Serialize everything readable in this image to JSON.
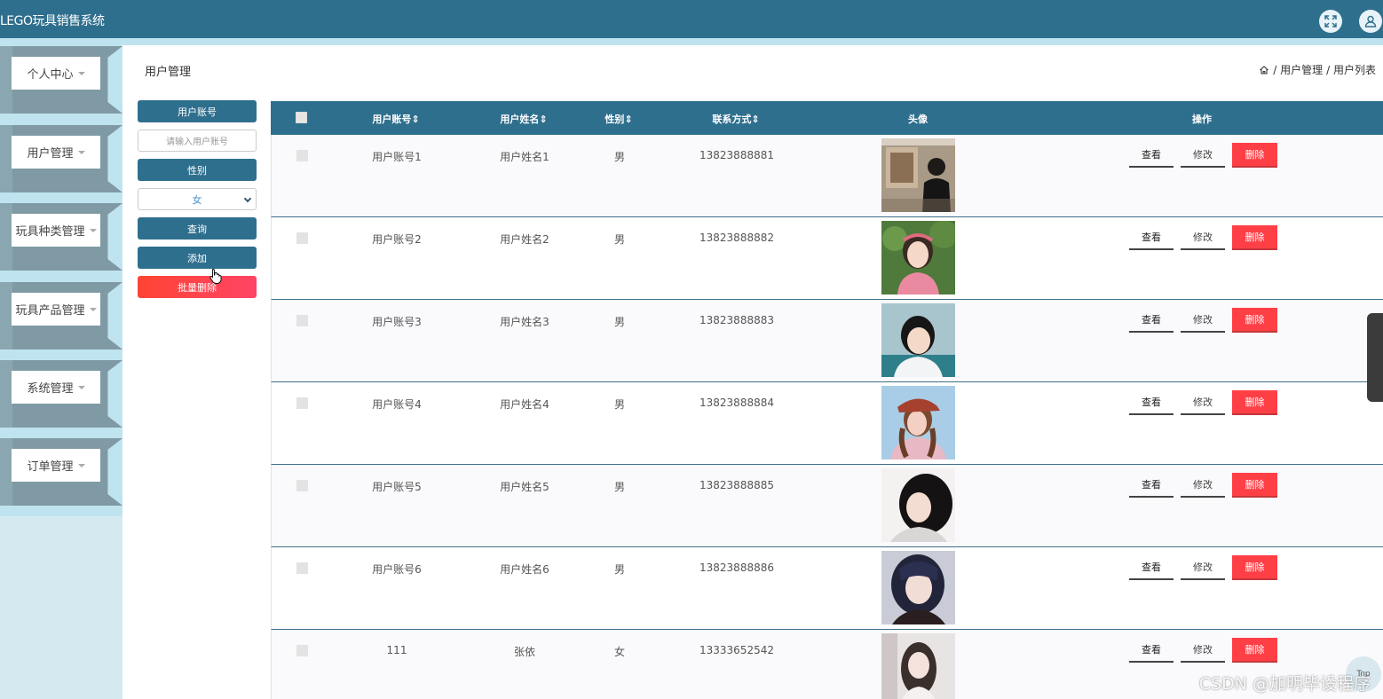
{
  "app": {
    "title": "LEGO玩具销售系统"
  },
  "topbar": {
    "fullscreen_icon": "fullscreen-icon",
    "user_icon": "user-icon"
  },
  "sidebar": {
    "items": [
      {
        "label": "个人中心"
      },
      {
        "label": "用户管理"
      },
      {
        "label": "玩具种类管理"
      },
      {
        "label": "玩具产品管理"
      },
      {
        "label": "系统管理"
      },
      {
        "label": "订单管理"
      }
    ]
  },
  "page": {
    "title": "用户管理",
    "breadcrumb": {
      "home_icon": "home-icon",
      "level1": "/ 用户管理",
      "level2": "/ 用户列表"
    }
  },
  "filters": {
    "account_label": "用户账号",
    "account_placeholder": "请输入用户账号",
    "gender_label": "性别",
    "gender_selected": "女",
    "search_button": "查询",
    "add_button": "添加",
    "batch_delete_button": "批量删除"
  },
  "table": {
    "headers": {
      "account": "用户账号",
      "name": "用户姓名",
      "gender": "性别",
      "phone": "联系方式",
      "avatar": "头像",
      "actions": "操作"
    },
    "sort_icon": "sort-icon",
    "action_labels": {
      "view": "查看",
      "edit": "修改",
      "delete": "删除"
    },
    "rows": [
      {
        "account": "用户账号1",
        "name": "用户姓名1",
        "gender": "男",
        "phone": "13823888881"
      },
      {
        "account": "用户账号2",
        "name": "用户姓名2",
        "gender": "男",
        "phone": "13823888882"
      },
      {
        "account": "用户账号3",
        "name": "用户姓名3",
        "gender": "男",
        "phone": "13823888883"
      },
      {
        "account": "用户账号4",
        "name": "用户姓名4",
        "gender": "男",
        "phone": "13823888884"
      },
      {
        "account": "用户账号5",
        "name": "用户姓名5",
        "gender": "男",
        "phone": "13823888885"
      },
      {
        "account": "用户账号6",
        "name": "用户姓名6",
        "gender": "男",
        "phone": "13823888886"
      },
      {
        "account": "111",
        "name": "张依",
        "gender": "女",
        "phone": "13333652542"
      }
    ]
  },
  "overlay": {
    "top_button": "Top",
    "watermark": "CSDN @加明毕设程序"
  },
  "colors": {
    "primary": "#2f6f8e",
    "danger": "#ff3f46",
    "sidebar_bg": "#bfe4ef"
  }
}
